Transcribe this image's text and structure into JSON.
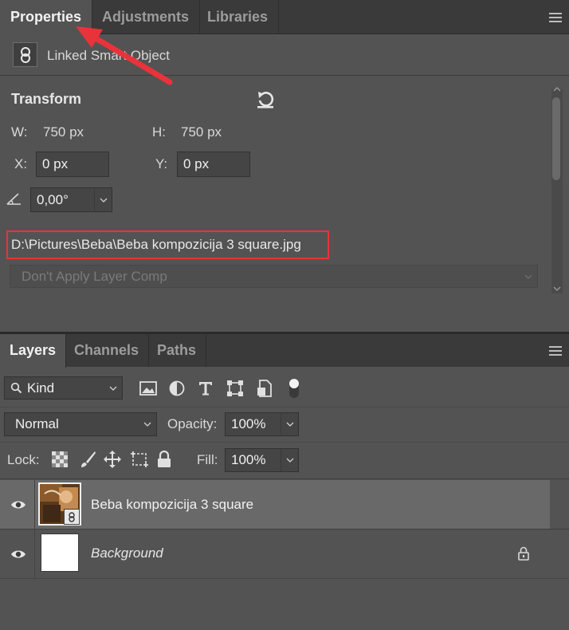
{
  "properties": {
    "tabs": [
      "Properties",
      "Adjustments",
      "Libraries"
    ],
    "object_type": "Linked Smart Object",
    "transform": {
      "title": "Transform",
      "w_label": "W:",
      "w_value": "750 px",
      "h_label": "H:",
      "h_value": "750 px",
      "x_label": "X:",
      "x_value": "0 px",
      "y_label": "Y:",
      "y_value": "0 px",
      "angle_value": "0,00°"
    },
    "file_path": "D:\\Pictures\\Beba\\Beba kompozicija 3 square.jpg",
    "layer_comp": "Don't Apply Layer Comp"
  },
  "layers": {
    "tabs": [
      "Layers",
      "Channels",
      "Paths"
    ],
    "filter_kind": "Kind",
    "blend_mode": "Normal",
    "opacity_label": "Opacity:",
    "opacity_value": "100%",
    "lock_label": "Lock:",
    "fill_label": "Fill:",
    "fill_value": "100%",
    "items": [
      {
        "name": "Beba kompozicija 3 square",
        "selected": true,
        "italic": false
      },
      {
        "name": "Background",
        "selected": false,
        "italic": true
      }
    ]
  },
  "colors": {
    "panel": "#535353",
    "tab_bar": "#3a3a3a",
    "highlight_red": "#e8333a",
    "selected_row": "#696969"
  }
}
